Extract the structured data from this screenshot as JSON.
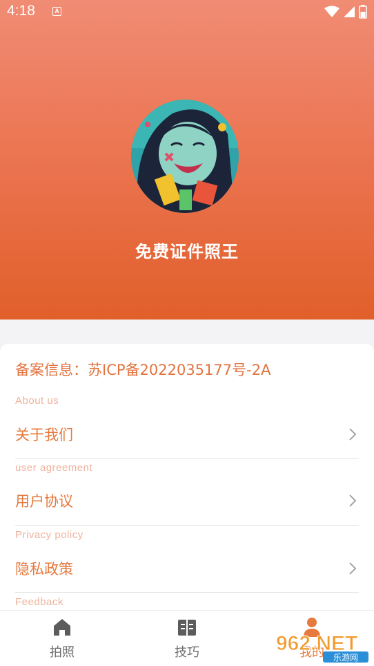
{
  "status": {
    "time": "4:18",
    "notif_badge": "A"
  },
  "header": {
    "app_name": "免费证件照王"
  },
  "card": {
    "icp": "备案信息：苏ICP备2022035177号-2A",
    "sections": [
      {
        "sub": "About us",
        "label": "关于我们"
      },
      {
        "sub": "user agreement",
        "label": "用户协议"
      },
      {
        "sub": "Privacy policy",
        "label": "隐私政策"
      },
      {
        "sub": "Feedback",
        "label": ""
      }
    ]
  },
  "tabs": [
    {
      "label": "拍照",
      "icon": "home-icon"
    },
    {
      "label": "技巧",
      "icon": "book-icon"
    },
    {
      "label": "我的",
      "icon": "person-icon",
      "active": true
    }
  ],
  "watermark": {
    "brand": "962.NET",
    "sub": "乐游网"
  },
  "colors": {
    "accent": "#e6793d",
    "header_top": "#f08c74",
    "header_bottom": "#e15f2a"
  }
}
